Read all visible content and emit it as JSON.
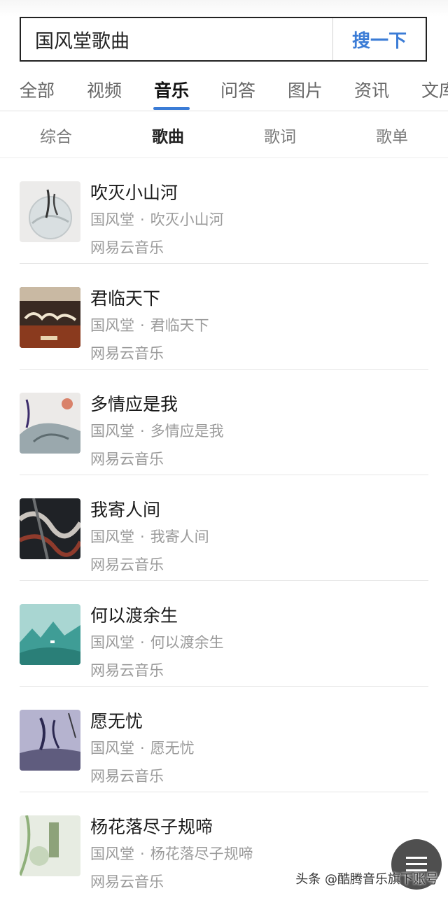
{
  "search": {
    "query": "国风堂歌曲",
    "button_label": "搜一下"
  },
  "tabs": [
    "全部",
    "视频",
    "音乐",
    "问答",
    "图片",
    "资讯",
    "文库"
  ],
  "subtabs": [
    "综合",
    "歌曲",
    "歌词",
    "歌单"
  ],
  "separator": "·",
  "songs": [
    {
      "title": "吹灭小山河",
      "artist": "国风堂",
      "album": "吹灭小山河",
      "source": "网易云音乐"
    },
    {
      "title": "君临天下",
      "artist": "国风堂",
      "album": "君临天下",
      "source": "网易云音乐"
    },
    {
      "title": "多情应是我",
      "artist": "国风堂",
      "album": "多情应是我",
      "source": "网易云音乐"
    },
    {
      "title": "我寄人间",
      "artist": "国风堂",
      "album": "我寄人间",
      "source": "网易云音乐"
    },
    {
      "title": "何以渡余生",
      "artist": "国风堂",
      "album": "何以渡余生",
      "source": "网易云音乐"
    },
    {
      "title": "愿无忧",
      "artist": "国风堂",
      "album": "愿无忧",
      "source": "网易云音乐"
    },
    {
      "title": "杨花落尽子规啼",
      "artist": "国风堂",
      "album": "杨花落尽子规啼",
      "source": "网易云音乐"
    }
  ],
  "fab_icon": "menu-icon",
  "watermark": "头条 @酷腾音乐旗下账号",
  "colors": {
    "accent": "#3b7cd6",
    "muted": "#9a9a9a"
  }
}
